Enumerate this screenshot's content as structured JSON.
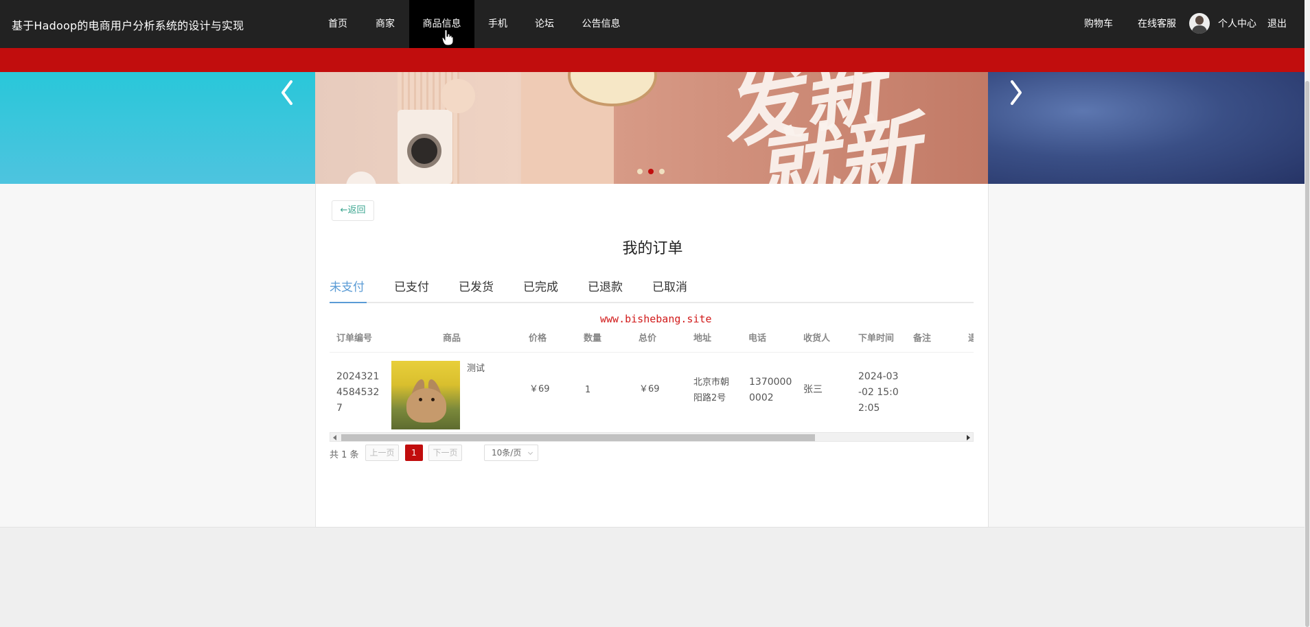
{
  "header": {
    "site_title": "基于Hadoop的电商用户分析系统的设计与实现",
    "nav": [
      "首页",
      "商家",
      "商品信息",
      "手机",
      "论坛",
      "公告信息"
    ],
    "active_nav": "商品信息",
    "right": {
      "cart": "购物车",
      "service": "在线客服",
      "profile": "个人中心",
      "logout": "退出"
    }
  },
  "banner": {
    "slide_count": 3,
    "active_slide": 2,
    "brush_text": "发新就新"
  },
  "colors": {
    "brand_red": "#c10d0d",
    "accent_blue": "#5a9bd5",
    "back_green": "#3aa58f"
  },
  "order_page": {
    "back_label": "返回",
    "title": "我的订单",
    "tabs": [
      "未支付",
      "已支付",
      "已发货",
      "已完成",
      "已退款",
      "已取消"
    ],
    "active_tab": "未支付",
    "watermark": "www.bishebang.site",
    "columns": [
      "订单编号",
      "商品",
      "价格",
      "数量",
      "总价",
      "地址",
      "电话",
      "收货人",
      "下单时间",
      "备注",
      "退"
    ],
    "rows": [
      {
        "order_no": "2024321\n4584532\n7",
        "product_name": "测试",
        "product_image": "rabbit-photo",
        "price": "￥69",
        "qty": "1",
        "total": "￥69",
        "address": "北京市朝\n阳路2号",
        "phone": "1370000\n0002",
        "receiver": "张三",
        "time": "2024-03\n-02 15:0\n2:05",
        "note": ""
      }
    ],
    "pagination": {
      "total_text": "共 1 条",
      "prev": "上一页",
      "current_page": "1",
      "next": "下一页",
      "page_size": "10条/页"
    }
  }
}
